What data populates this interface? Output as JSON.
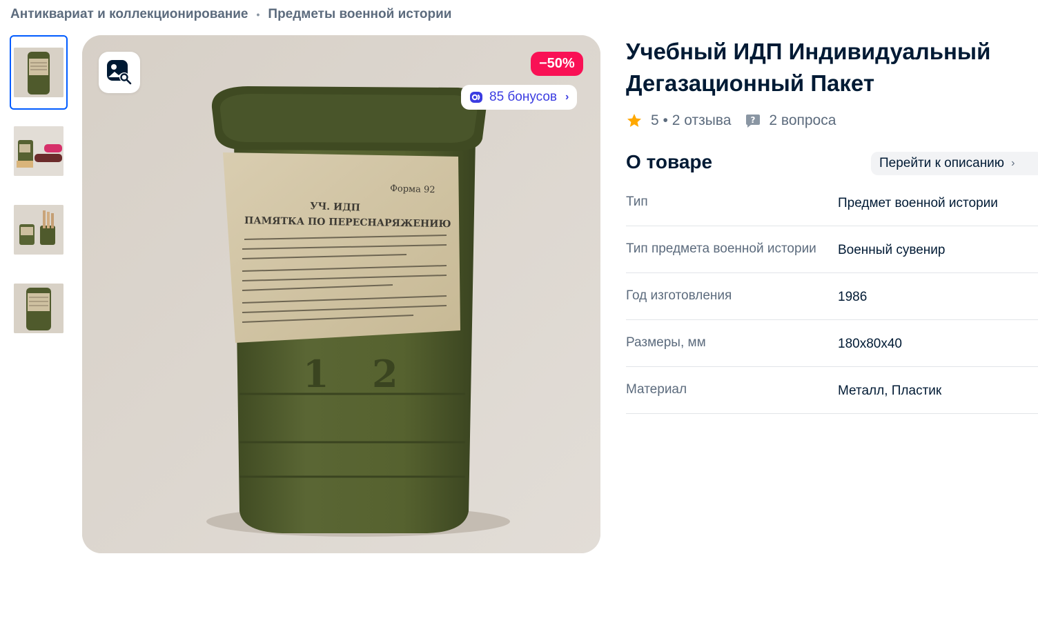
{
  "breadcrumbs": [
    "Антиквариат и коллекционирование",
    "Предметы военной истории"
  ],
  "gallery": {
    "thumbnails": [
      "thumb-1",
      "thumb-2",
      "thumb-3",
      "thumb-4"
    ],
    "active_index": 0,
    "discount_badge": "−50%",
    "bonus_label": "85 бонусов",
    "label_text": {
      "form": "Форма 92",
      "heading": "УЧ. ИДП",
      "subheading": "ПАМЯТКА ПО ПЕРЕСНАРЯЖЕНИЮ"
    }
  },
  "product": {
    "title": "Учебный ИДП Индивидуальный Дегазационный Пакет",
    "rating": "5",
    "reviews": "2 отзыва",
    "questions": "2 вопроса"
  },
  "about": {
    "title": "О товаре",
    "goto_label": "Перейти к описанию",
    "properties": [
      {
        "key": "Тип",
        "value": "Предмет военной истории"
      },
      {
        "key": "Тип предмета военной истории",
        "value": "Военный сувенир"
      },
      {
        "key": "Год изготовления",
        "value": "1986"
      },
      {
        "key": "Размеры, мм",
        "value": "180x80x40"
      },
      {
        "key": "Материал",
        "value": "Металл, Пластик"
      }
    ]
  },
  "colors": {
    "accent": "#005bff",
    "discount": "#f91155",
    "bonus": "#3b3ce1",
    "star": "#ffa800"
  }
}
